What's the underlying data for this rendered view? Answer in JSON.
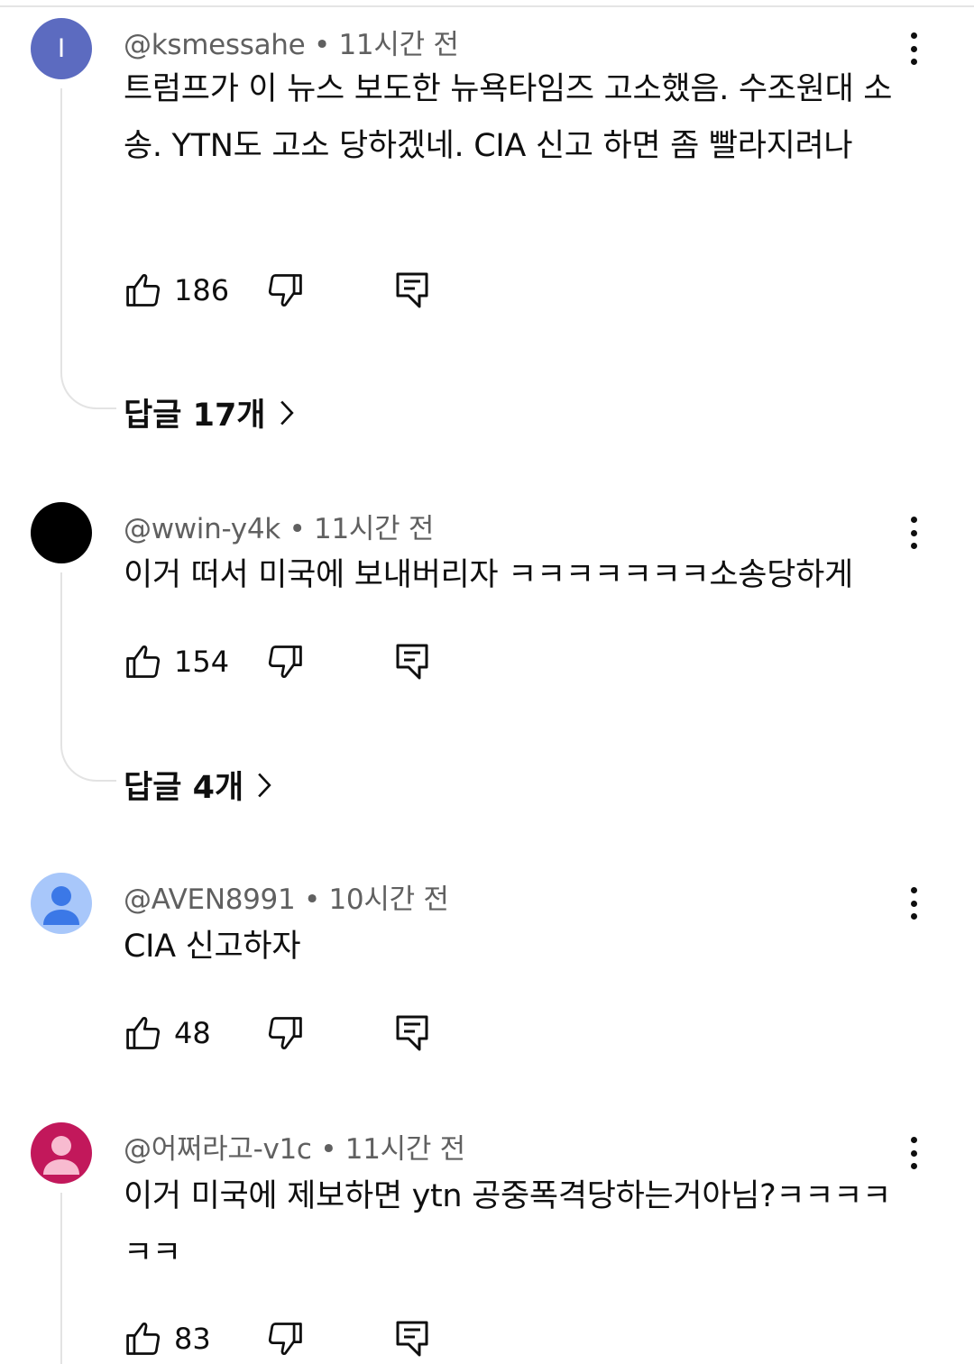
{
  "comments": [
    {
      "author": "@ksmessahe",
      "time": "11시간 전",
      "avatar_letter": "I",
      "avatar_color": "#5c6bc0",
      "text": "트럼프가 이 뉴스 보도한 뉴욕타임즈 고소했음. 수조원대 소송. YTN도 고소 당하겠네. CIA 신고 하면 좀 빨라지려나",
      "likes": "186",
      "replies": "답글 17개"
    },
    {
      "author": "@wwin-y4k",
      "time": "11시간 전",
      "avatar_color": "#000000",
      "text": "이거 떠서 미국에 보내버리자 ㅋㅋㅋㅋㅋㅋㅋ소송당하게",
      "likes": "154",
      "replies": "답글 4개"
    },
    {
      "author": "@AVEN8991",
      "time": "10시간 전",
      "avatar_color": "#a8c7fa",
      "avatar_icon": "default-person-icon",
      "text": "CIA 신고하자",
      "likes": "48"
    },
    {
      "author": "@어쩌라고-v1c",
      "time": "11시간 전",
      "avatar_color": "#c2185b",
      "avatar_icon": "default-person-icon",
      "text": "이거 미국에 제보하면 ytn 공중폭격당하는거아님?ㅋㅋㅋㅋㅋㅋ",
      "likes": "83"
    }
  ],
  "separator": " • "
}
